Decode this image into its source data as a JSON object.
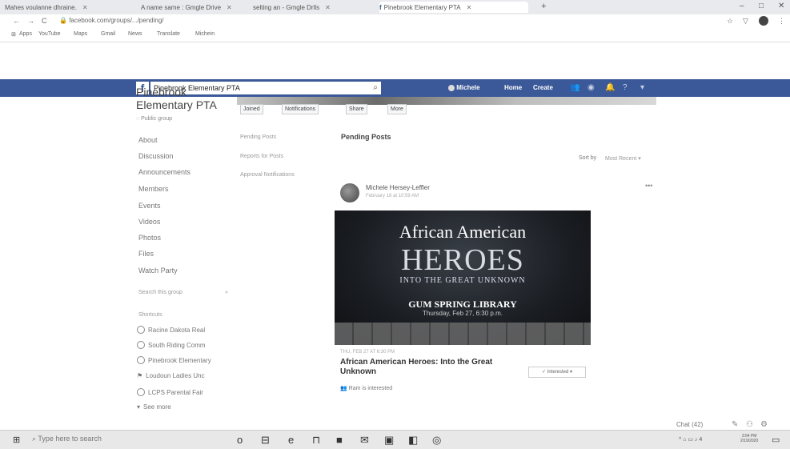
{
  "browser": {
    "tabs": [
      {
        "label": "Mahes voulanne dhraine.",
        "active": false
      },
      {
        "label": "A name same : Gmgle Drive",
        "active": false
      },
      {
        "label": "selting an - Gmgle Drlls",
        "active": false
      },
      {
        "label": "Pinebrook Elementary PTA",
        "active": true
      }
    ],
    "new_tab": "+",
    "window_controls": [
      "–",
      "□",
      "✕"
    ],
    "address": "facebook.com/groups/.../pending/",
    "bookmarks": [
      "Apps",
      "YouTube",
      "Maps",
      "Gmail",
      "News",
      "Translate",
      "Michein"
    ],
    "nav_icons": [
      "←",
      "→",
      "C"
    ]
  },
  "facebook": {
    "logo": "f",
    "search_value": "Pinebrook Elementary PTA",
    "user": "Michele",
    "nav": [
      "Home",
      "Create"
    ],
    "nav_icons": [
      "friends-icon",
      "messenger-icon",
      "bell-icon",
      "help-icon",
      "caret-icon"
    ],
    "brand_color": "#3b5998"
  },
  "group": {
    "title": "Pinebrook Elementary PTA",
    "privacy": "Public group",
    "nav": [
      "About",
      "Discussion",
      "Announcements",
      "Members",
      "Events",
      "Videos",
      "Photos",
      "Files",
      "Watch Party"
    ],
    "search_placeholder": "Search this group",
    "shortcuts_label": "Shortcuts",
    "shortcuts": [
      "Racine Dakota Real",
      "South Riding Comm",
      "Pinebrook Elementary",
      "Loudoun Ladies Unc",
      "LCPS Parental Fair",
      "See more"
    ],
    "actions": [
      "Joined",
      "Notifications",
      "Share",
      "More"
    ]
  },
  "pending_nav": [
    "Pending Posts",
    "Reports for Posts",
    "Approval Notifications"
  ],
  "main": {
    "title": "Pending Posts",
    "sort_label": "Sort by",
    "sort_value": "Most Recent",
    "post": {
      "author": "Michele Hersey-Leffler",
      "time": "February 18 at 10:59 AM",
      "more": "•••",
      "poster": {
        "line1": "African American",
        "line2": "HEROES",
        "line3": "INTO THE GREAT UNKNOWN",
        "line4": "GUM SPRING LIBRARY",
        "line5": "Thursday, Feb 27, 6:30 p.m."
      },
      "event_date": "THU, FEB 27 AT 6:30 PM",
      "event_title": "African American Heroes: Into the Great Unknown",
      "interested": "Interested",
      "going": "Ram is interested"
    }
  },
  "chat": {
    "label": "Chat (42)"
  },
  "taskbar": {
    "start": "⊞",
    "search": "Type here to search",
    "icons": [
      "o",
      "⊟",
      "e",
      "⊓",
      "■",
      "✉",
      "▣",
      "◧",
      "◎"
    ],
    "tray": "^ ⌂ ▭ ♪ 4",
    "time": "3:54 PM",
    "date": "2/19/2020"
  }
}
